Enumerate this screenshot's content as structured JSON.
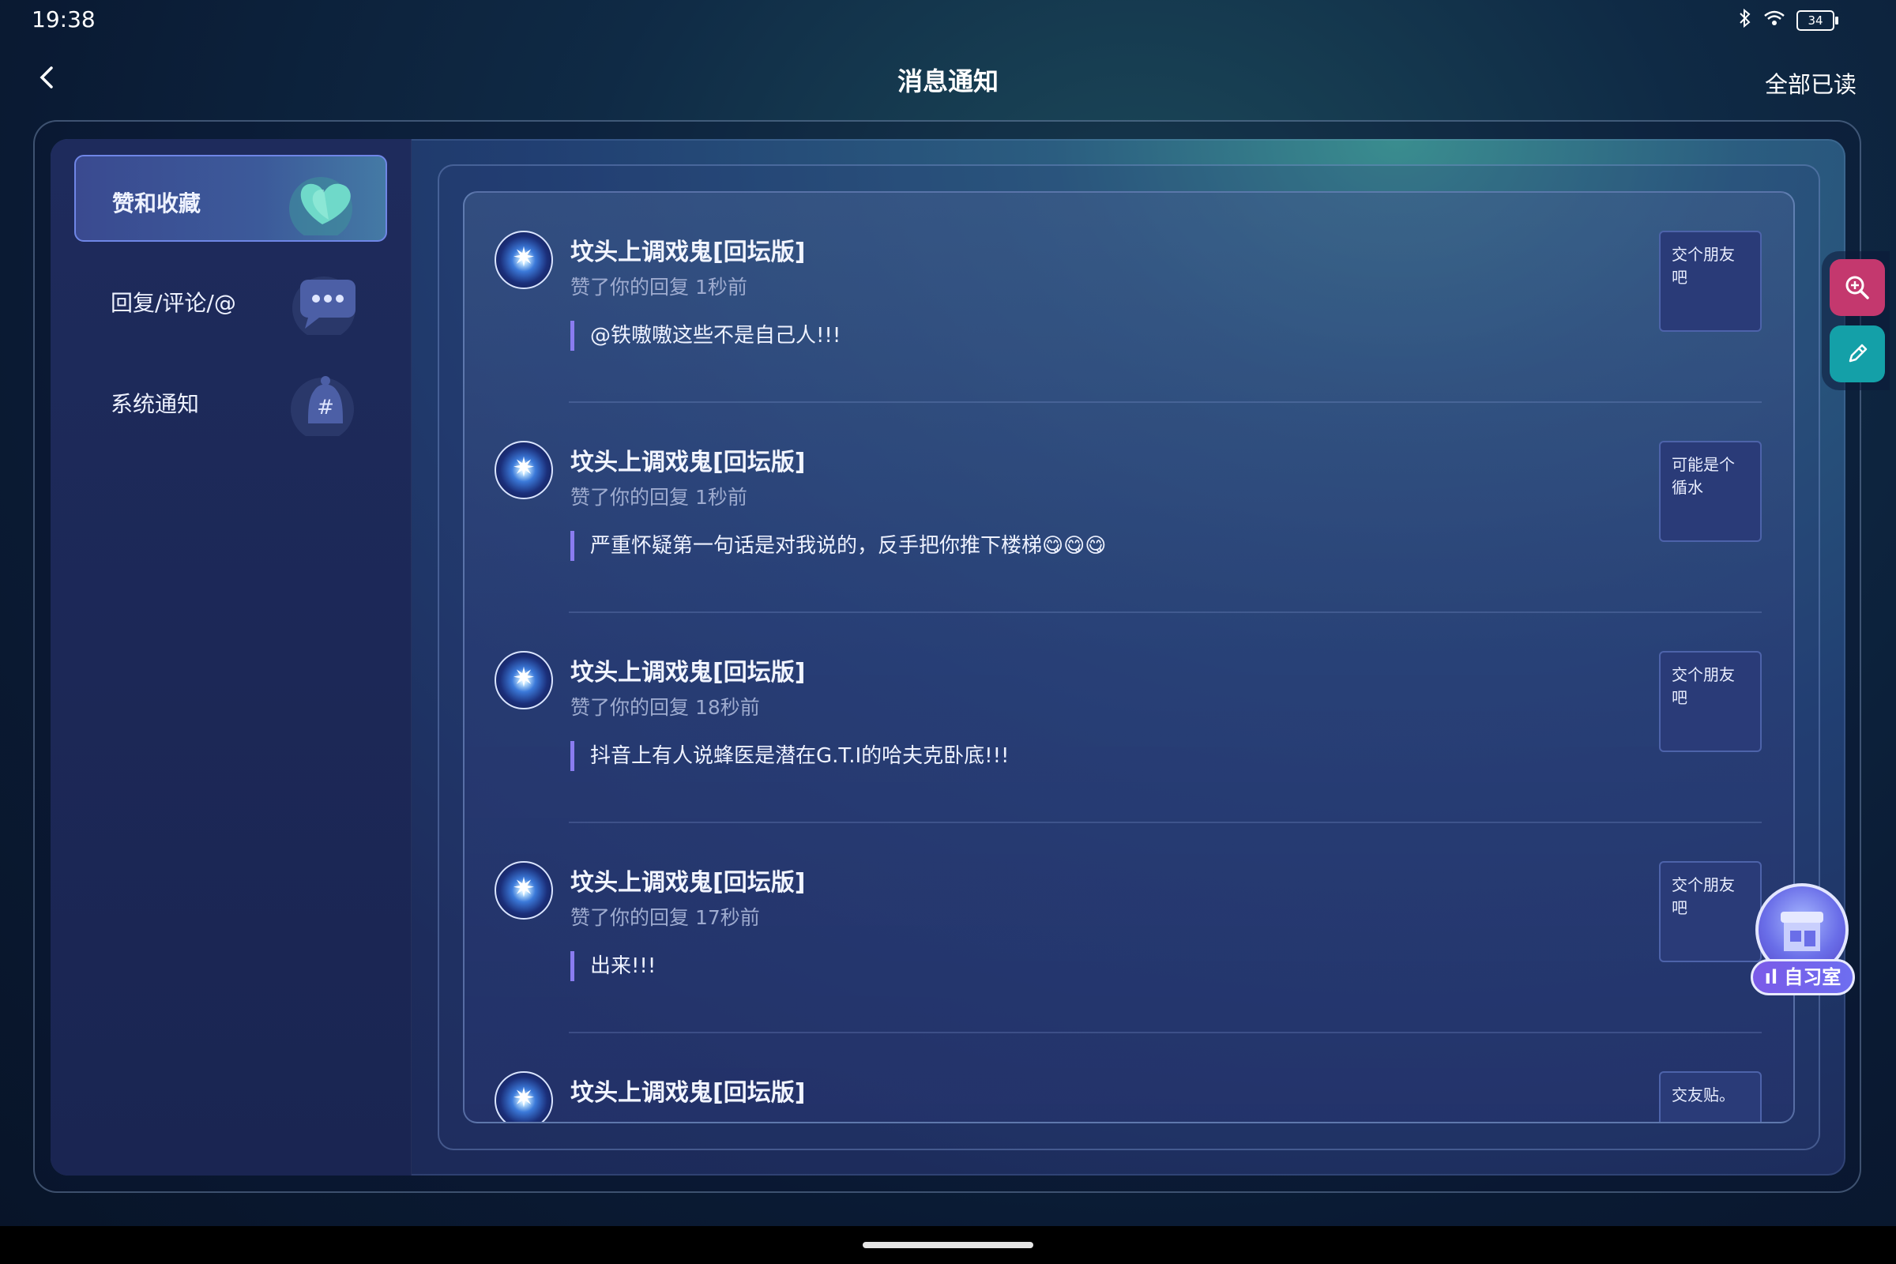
{
  "status_bar": {
    "time": "19:38",
    "battery": "34"
  },
  "header": {
    "title": "消息通知",
    "mark_all_read": "全部已读"
  },
  "sidebar": {
    "items": [
      {
        "label": "赞和收藏",
        "active": true,
        "icon": "heart-icon"
      },
      {
        "label": "回复/评论/@",
        "active": false,
        "icon": "chat-bubble-icon"
      },
      {
        "label": "系统通知",
        "active": false,
        "icon": "bell-icon"
      }
    ]
  },
  "messages": [
    {
      "user": "坟头上调戏鬼[回坛版]",
      "meta": "赞了你的回复 1秒前",
      "quote": "@铁嗷嗷这些不是自己人!!!",
      "thumb": "交个朋友吧"
    },
    {
      "user": "坟头上调戏鬼[回坛版]",
      "meta": "赞了你的回复 1秒前",
      "quote": "严重怀疑第一句话是对我说的，反手把你推下楼梯😋😋😋",
      "thumb": "可能是个循水"
    },
    {
      "user": "坟头上调戏鬼[回坛版]",
      "meta": "赞了你的回复 18秒前",
      "quote": "抖音上有人说蜂医是潜在G.T.I的哈夫克卧底!!!",
      "thumb": "交个朋友吧"
    },
    {
      "user": "坟头上调戏鬼[回坛版]",
      "meta": "赞了你的回复 17秒前",
      "quote": "出来!!!",
      "thumb": "交个朋友吧"
    },
    {
      "user": "坟头上调戏鬼[回坛版]",
      "meta": "",
      "quote": "",
      "thumb": "交友贴。"
    }
  ],
  "floating": {
    "study_room_label": "自习室"
  },
  "colors": {
    "accent": "#6f86e6",
    "quote_bar": "#8a7cf0",
    "search_btn": "#c4386e",
    "edit_btn": "#14a0a8"
  }
}
